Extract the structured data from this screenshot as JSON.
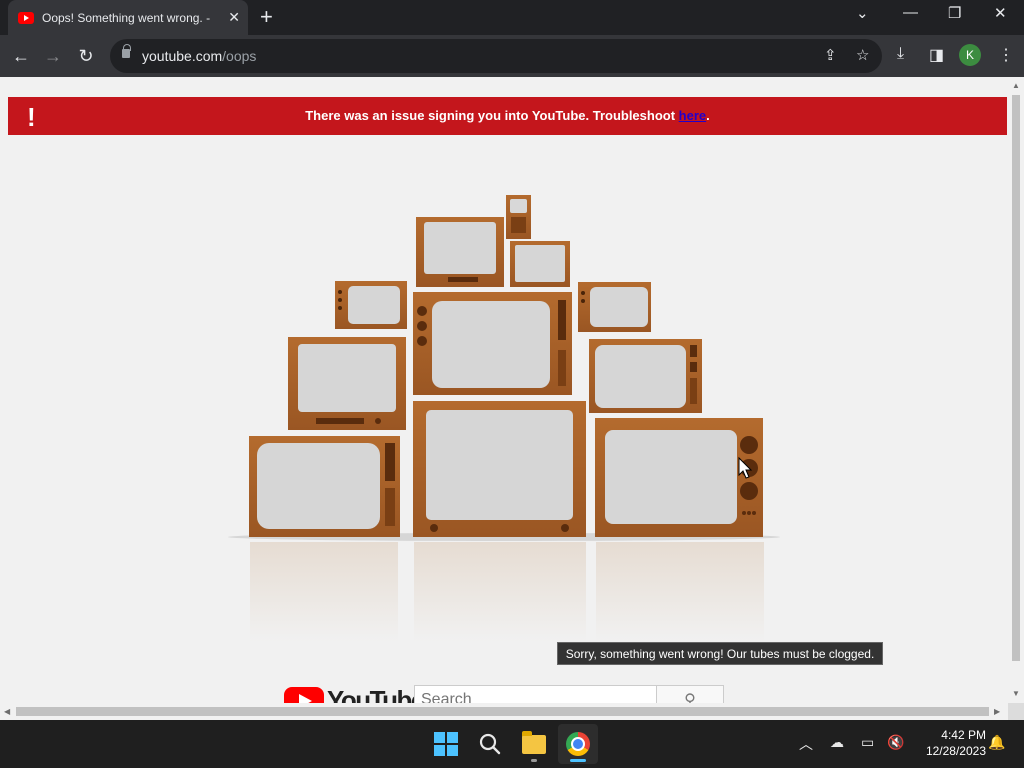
{
  "browser": {
    "tab_title": "Oops! Something went wrong. -",
    "tab_close": "✕",
    "new_tab": "+",
    "url_domain": "youtube.com",
    "url_path": "/oops",
    "profile_initial": "K"
  },
  "page": {
    "banner_text": "There was an issue signing you into YouTube. Troubleshoot ",
    "banner_link": "here",
    "banner_end": ".",
    "banner_icon": "!",
    "tooltip": "Sorry, something went wrong! Our tubes must be clogged.",
    "logo_text": "YouTube",
    "search_placeholder": "Search"
  },
  "taskbar": {
    "time": "4:42 PM",
    "date": "12/28/2023"
  },
  "colors": {
    "banner": "#c4161c",
    "tv_wood": "#a8612a",
    "tv_screen": "#d6d6d6"
  }
}
